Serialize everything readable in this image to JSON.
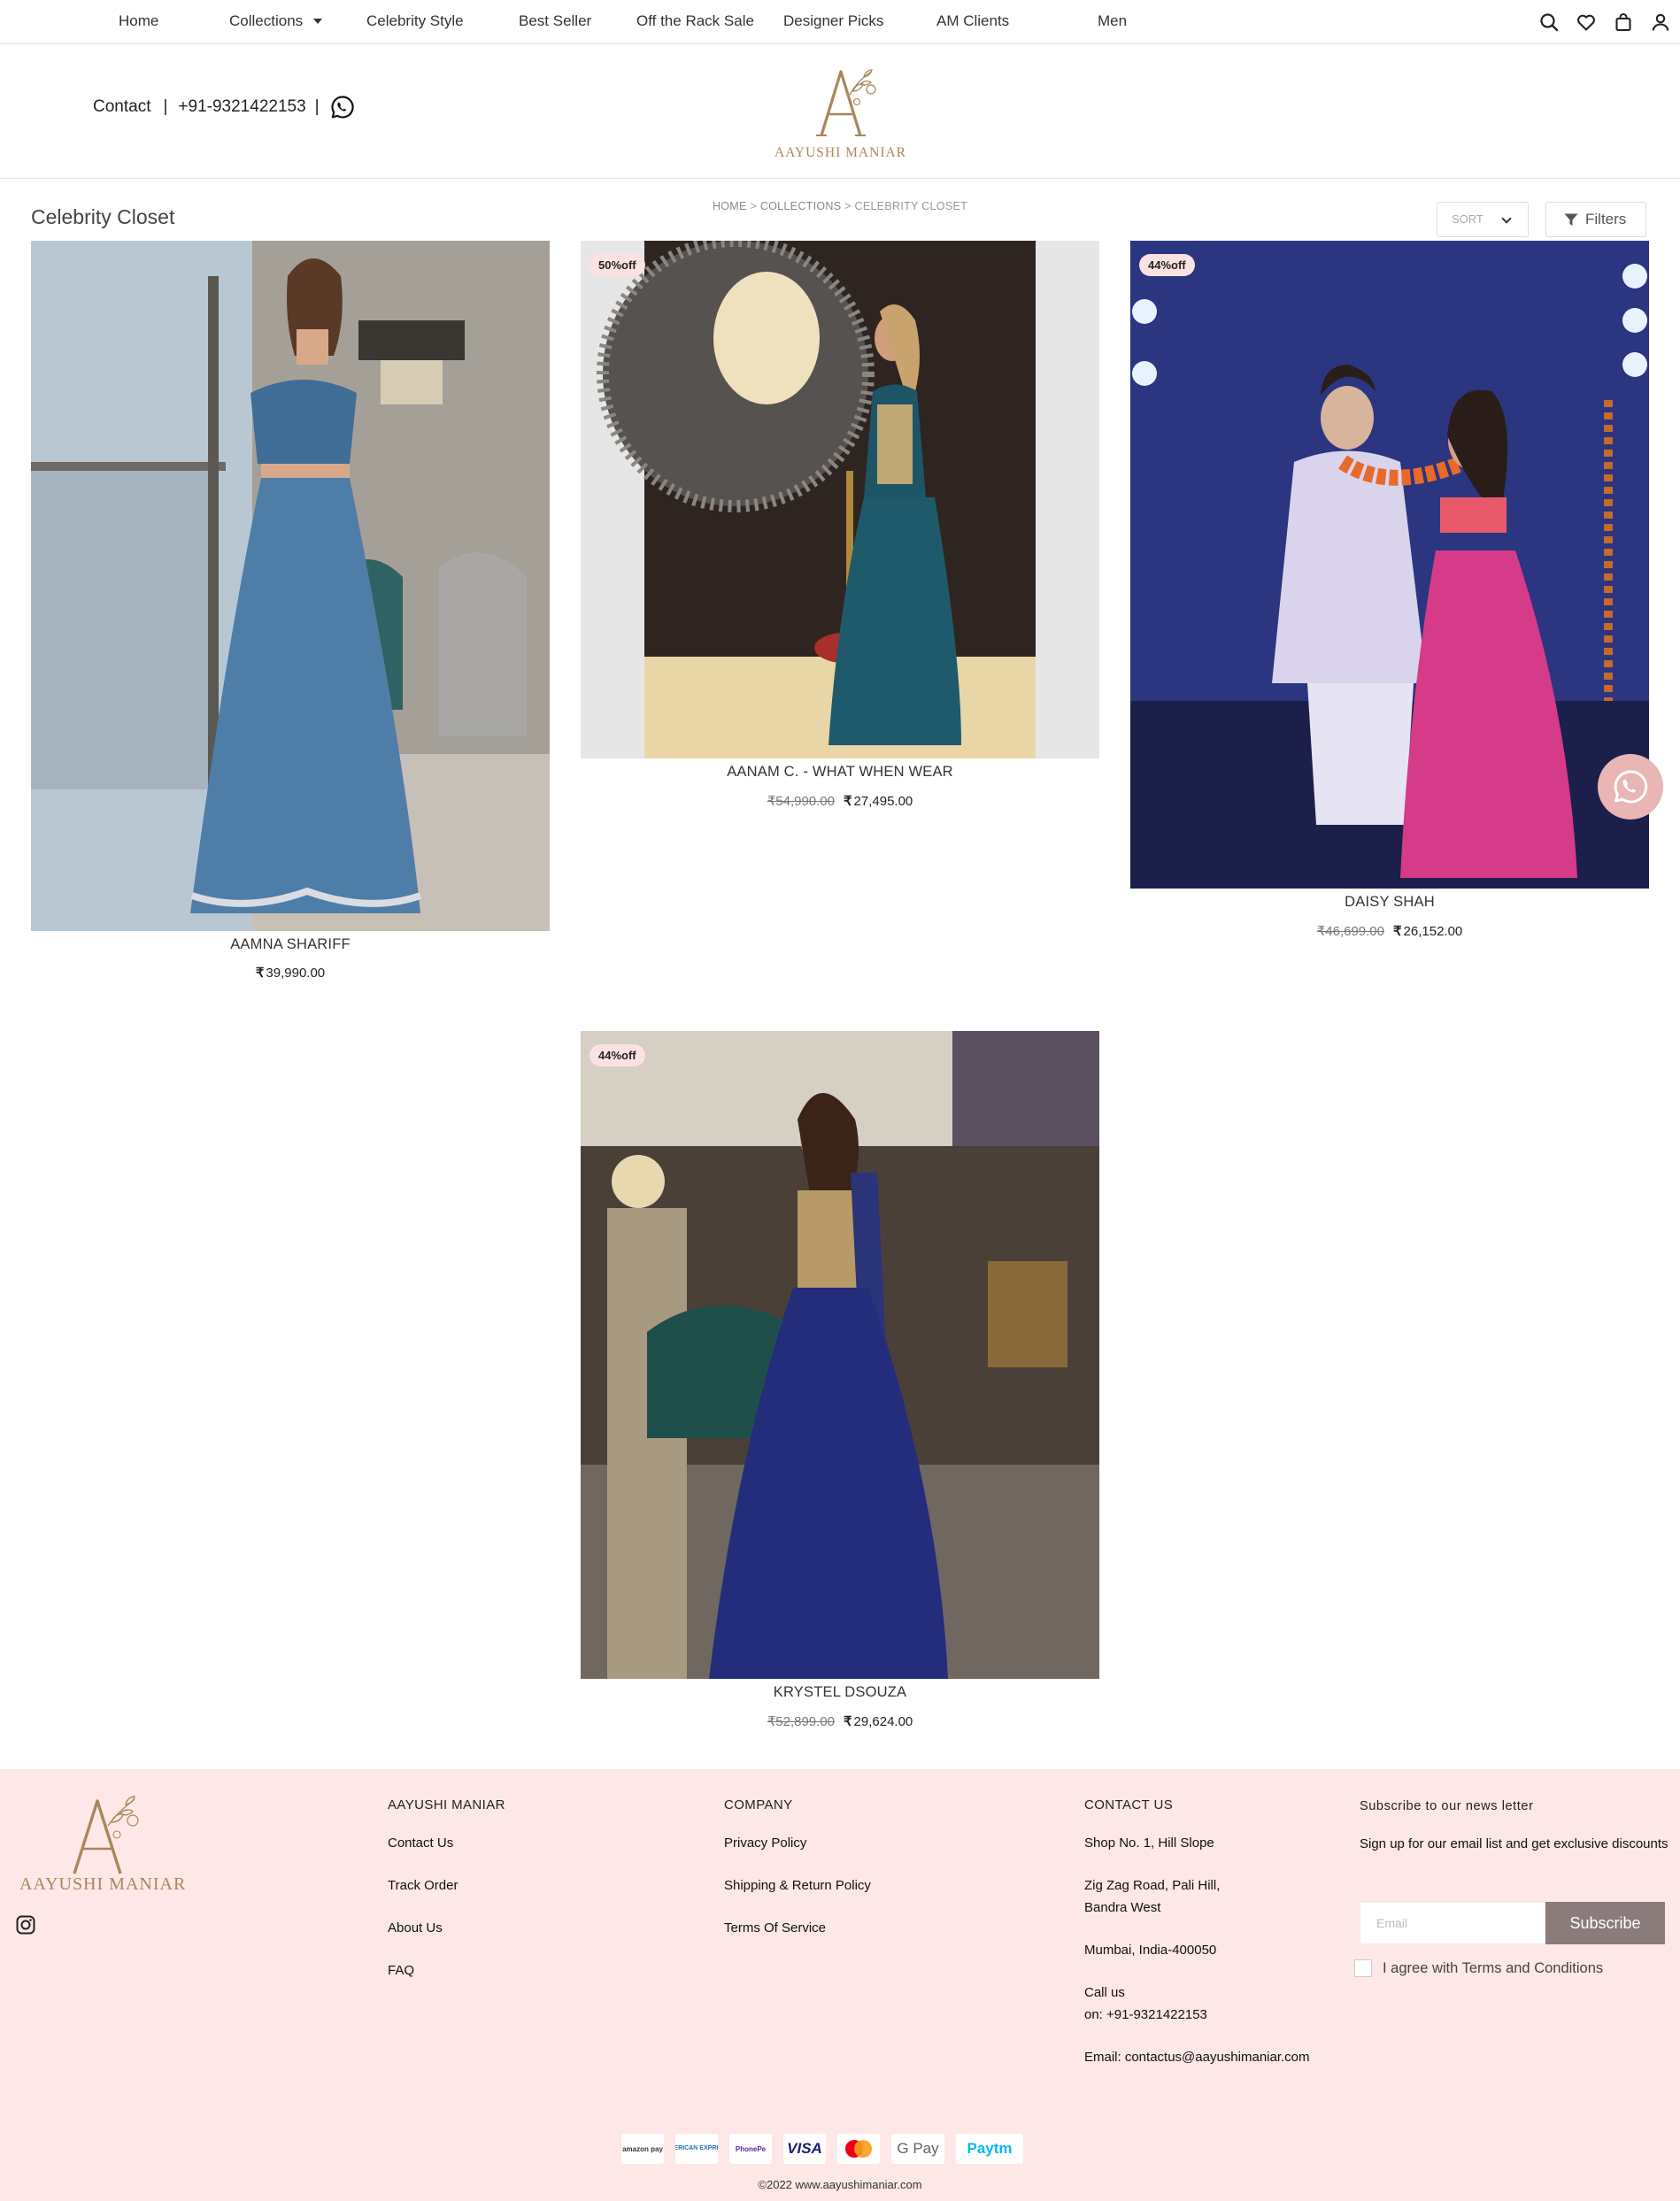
{
  "nav": {
    "items": [
      {
        "label": "Home"
      },
      {
        "label": "Collections"
      },
      {
        "label": "Celebrity Style"
      },
      {
        "label": "Best Seller"
      },
      {
        "label": "Off the Rack Sale"
      },
      {
        "label": "Designer Picks"
      },
      {
        "label": "AM Clients"
      },
      {
        "label": "Men"
      }
    ],
    "icons": [
      "search-icon",
      "heart-icon",
      "bag-icon",
      "user-icon"
    ]
  },
  "header": {
    "contact_label": "Contact",
    "sep": "|",
    "phone": "+91-9321422153",
    "brand": "AAYUSHI MANIAR"
  },
  "listing": {
    "title": "Celebrity Closet",
    "breadcrumb": [
      "HOME",
      "COLLECTIONS",
      "CELEBRITY CLOSET"
    ],
    "breadcrumb_sep": ">",
    "sort_label": "SORT",
    "filters_label": "Filters"
  },
  "currency_symbol": "₹",
  "products": [
    {
      "name": "AAMNA SHARIFF",
      "badge": "",
      "old_price": "",
      "price": "39,990.00"
    },
    {
      "name": "AANAM C. - WHAT WHEN WEAR",
      "badge": "50%off",
      "old_price": "54,990.00",
      "price": "27,495.00"
    },
    {
      "name": "DAISY SHAH",
      "badge": "44%off",
      "old_price": "46,699.00",
      "price": "26,152.00"
    },
    {
      "name": "KRYSTEL DSOUZA",
      "badge": "44%off",
      "old_price": "52,899.00",
      "price": "29,624.00"
    }
  ],
  "footer": {
    "brand": "AAYUSHI MANIAR",
    "col1": {
      "head": "AAYUSHI MANIAR",
      "links": [
        "Contact Us",
        "Track Order",
        "About Us",
        "FAQ"
      ]
    },
    "col2": {
      "head": "COMPANY",
      "links": [
        "Privacy Policy",
        "Shipping & Return Policy",
        "Terms Of Service"
      ]
    },
    "col3": {
      "head": "CONTACT US",
      "lines": [
        "Shop No. 1, Hill Slope",
        "Zig Zag Road, Pali Hill,",
        "Bandra West",
        "Mumbai, India-400050",
        "Call us",
        "on: +91-9321422153",
        "Email: contactus@aayushimaniar.com"
      ]
    },
    "newsletter": {
      "title": "Subscribe to our news letter",
      "text": "Sign up for our email list and get exclusive discounts",
      "placeholder": "Email",
      "button": "Subscribe",
      "agree": "I agree with Terms and Conditions"
    },
    "payments": [
      "amazon pay",
      "AMERICAN EXPRESS",
      "PhonePe",
      "VISA",
      "MasterCard",
      "G Pay",
      "Paytm"
    ],
    "copyright": "©2022 www.aayushimaniar.com"
  },
  "colors": {
    "brand_gold": "#a8875a",
    "footer_bg": "#fde7e7",
    "badge_bg": "#fbe2e2",
    "subscribe_bg": "#8b7b7b",
    "whatsapp_float_bg": "#e9b5b5"
  }
}
